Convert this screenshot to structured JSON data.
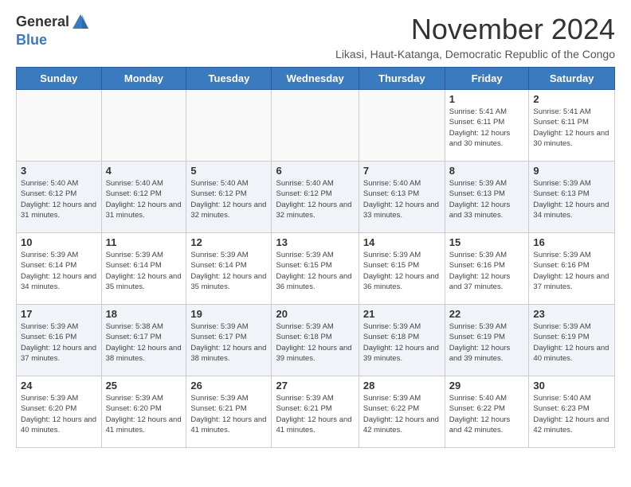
{
  "header": {
    "logo": {
      "general": "General",
      "blue": "Blue",
      "tagline": ""
    },
    "title": "November 2024",
    "subtitle": "Likasi, Haut-Katanga, Democratic Republic of the Congo"
  },
  "calendar": {
    "days_of_week": [
      "Sunday",
      "Monday",
      "Tuesday",
      "Wednesday",
      "Thursday",
      "Friday",
      "Saturday"
    ],
    "weeks": [
      [
        {
          "day": "",
          "info": ""
        },
        {
          "day": "",
          "info": ""
        },
        {
          "day": "",
          "info": ""
        },
        {
          "day": "",
          "info": ""
        },
        {
          "day": "",
          "info": ""
        },
        {
          "day": "1",
          "info": "Sunrise: 5:41 AM\nSunset: 6:11 PM\nDaylight: 12 hours and 30 minutes."
        },
        {
          "day": "2",
          "info": "Sunrise: 5:41 AM\nSunset: 6:11 PM\nDaylight: 12 hours and 30 minutes."
        }
      ],
      [
        {
          "day": "3",
          "info": "Sunrise: 5:40 AM\nSunset: 6:12 PM\nDaylight: 12 hours and 31 minutes."
        },
        {
          "day": "4",
          "info": "Sunrise: 5:40 AM\nSunset: 6:12 PM\nDaylight: 12 hours and 31 minutes."
        },
        {
          "day": "5",
          "info": "Sunrise: 5:40 AM\nSunset: 6:12 PM\nDaylight: 12 hours and 32 minutes."
        },
        {
          "day": "6",
          "info": "Sunrise: 5:40 AM\nSunset: 6:12 PM\nDaylight: 12 hours and 32 minutes."
        },
        {
          "day": "7",
          "info": "Sunrise: 5:40 AM\nSunset: 6:13 PM\nDaylight: 12 hours and 33 minutes."
        },
        {
          "day": "8",
          "info": "Sunrise: 5:39 AM\nSunset: 6:13 PM\nDaylight: 12 hours and 33 minutes."
        },
        {
          "day": "9",
          "info": "Sunrise: 5:39 AM\nSunset: 6:13 PM\nDaylight: 12 hours and 34 minutes."
        }
      ],
      [
        {
          "day": "10",
          "info": "Sunrise: 5:39 AM\nSunset: 6:14 PM\nDaylight: 12 hours and 34 minutes."
        },
        {
          "day": "11",
          "info": "Sunrise: 5:39 AM\nSunset: 6:14 PM\nDaylight: 12 hours and 35 minutes."
        },
        {
          "day": "12",
          "info": "Sunrise: 5:39 AM\nSunset: 6:14 PM\nDaylight: 12 hours and 35 minutes."
        },
        {
          "day": "13",
          "info": "Sunrise: 5:39 AM\nSunset: 6:15 PM\nDaylight: 12 hours and 36 minutes."
        },
        {
          "day": "14",
          "info": "Sunrise: 5:39 AM\nSunset: 6:15 PM\nDaylight: 12 hours and 36 minutes."
        },
        {
          "day": "15",
          "info": "Sunrise: 5:39 AM\nSunset: 6:16 PM\nDaylight: 12 hours and 37 minutes."
        },
        {
          "day": "16",
          "info": "Sunrise: 5:39 AM\nSunset: 6:16 PM\nDaylight: 12 hours and 37 minutes."
        }
      ],
      [
        {
          "day": "17",
          "info": "Sunrise: 5:39 AM\nSunset: 6:16 PM\nDaylight: 12 hours and 37 minutes."
        },
        {
          "day": "18",
          "info": "Sunrise: 5:38 AM\nSunset: 6:17 PM\nDaylight: 12 hours and 38 minutes."
        },
        {
          "day": "19",
          "info": "Sunrise: 5:39 AM\nSunset: 6:17 PM\nDaylight: 12 hours and 38 minutes."
        },
        {
          "day": "20",
          "info": "Sunrise: 5:39 AM\nSunset: 6:18 PM\nDaylight: 12 hours and 39 minutes."
        },
        {
          "day": "21",
          "info": "Sunrise: 5:39 AM\nSunset: 6:18 PM\nDaylight: 12 hours and 39 minutes."
        },
        {
          "day": "22",
          "info": "Sunrise: 5:39 AM\nSunset: 6:19 PM\nDaylight: 12 hours and 39 minutes."
        },
        {
          "day": "23",
          "info": "Sunrise: 5:39 AM\nSunset: 6:19 PM\nDaylight: 12 hours and 40 minutes."
        }
      ],
      [
        {
          "day": "24",
          "info": "Sunrise: 5:39 AM\nSunset: 6:20 PM\nDaylight: 12 hours and 40 minutes."
        },
        {
          "day": "25",
          "info": "Sunrise: 5:39 AM\nSunset: 6:20 PM\nDaylight: 12 hours and 41 minutes."
        },
        {
          "day": "26",
          "info": "Sunrise: 5:39 AM\nSunset: 6:21 PM\nDaylight: 12 hours and 41 minutes."
        },
        {
          "day": "27",
          "info": "Sunrise: 5:39 AM\nSunset: 6:21 PM\nDaylight: 12 hours and 41 minutes."
        },
        {
          "day": "28",
          "info": "Sunrise: 5:39 AM\nSunset: 6:22 PM\nDaylight: 12 hours and 42 minutes."
        },
        {
          "day": "29",
          "info": "Sunrise: 5:40 AM\nSunset: 6:22 PM\nDaylight: 12 hours and 42 minutes."
        },
        {
          "day": "30",
          "info": "Sunrise: 5:40 AM\nSunset: 6:23 PM\nDaylight: 12 hours and 42 minutes."
        }
      ]
    ]
  }
}
